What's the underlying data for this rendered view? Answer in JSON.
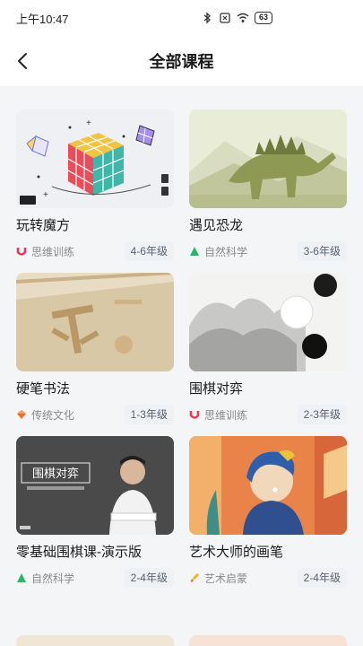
{
  "status_bar": {
    "time": "上午10:47",
    "battery": "63"
  },
  "header": {
    "title": "全部课程"
  },
  "courses": [
    {
      "title": "玩转魔方",
      "category": "思维训练",
      "category_icon": "u-icon",
      "grade": "4-6年级"
    },
    {
      "title": "遇见恐龙",
      "category": "自然科学",
      "category_icon": "triangle-icon",
      "grade": "3-6年级"
    },
    {
      "title": "硬笔书法",
      "category": "传统文化",
      "category_icon": "diamond-icon",
      "grade": "1-3年级"
    },
    {
      "title": "围棋对弈",
      "category": "思维训练",
      "category_icon": "u-icon",
      "grade": "2-3年级"
    },
    {
      "title": "零基础围棋课-演示版",
      "category": "自然科学",
      "category_icon": "triangle-icon",
      "grade": "2-4年级",
      "thumb_text": "围棋对弈"
    },
    {
      "title": "艺术大师的画笔",
      "category": "艺术启蒙",
      "category_icon": "brush-icon",
      "grade": "2-4年级"
    }
  ],
  "colors": {
    "thinking": "#e8395a",
    "science": "#2fb36b",
    "culture": "#f06a2a",
    "art": "#f2b21b"
  }
}
